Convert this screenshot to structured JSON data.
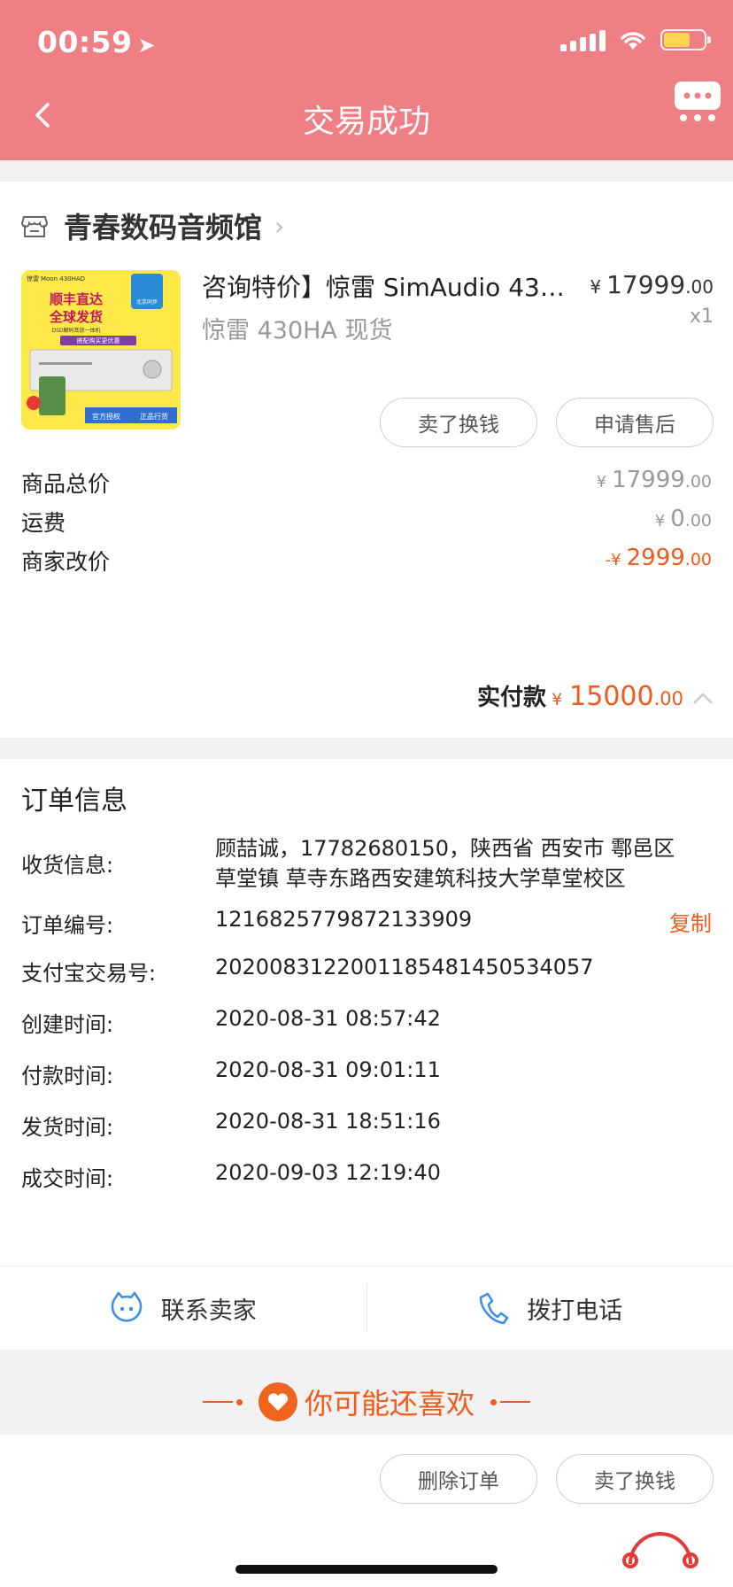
{
  "status_bar": {
    "time": "00:59"
  },
  "header": {
    "title": "交易成功"
  },
  "shop": {
    "name": "青春数码音频馆"
  },
  "product": {
    "title": "咨询特价】惊雷 SimAudio 430...",
    "sku": "惊雷 430HA 现货",
    "price_currency": "¥",
    "price_int": "17999",
    "price_dec": ".00",
    "qty": "x1",
    "image_texts": [
      "惊雷",
      "Moon 430HAD",
      "顺丰直达",
      "全球发货",
      "DSD解码耳放一体机",
      "搭配购买更优惠",
      "北京同步",
      "官方授权",
      "正品行货"
    ]
  },
  "item_actions": {
    "sell_label": "卖了换钱",
    "aftersale_label": "申请售后"
  },
  "fees": {
    "goods_total_label": "商品总价",
    "goods_total_cur": "¥",
    "goods_total_int": "17999",
    "goods_total_dec": ".00",
    "shipping_label": "运费",
    "shipping_cur": "¥",
    "shipping_int": "0",
    "shipping_dec": ".00",
    "adjust_label": "商家改价",
    "adjust_cur": "-¥",
    "adjust_int": "2999",
    "adjust_dec": ".00",
    "paid_label": "实付款",
    "paid_cur": "¥",
    "paid_int": "15000",
    "paid_dec": ".00"
  },
  "order_info": {
    "title": "订单信息",
    "receiver_label": "收货信息:",
    "receiver_line1": "顾喆诚，17782680150，陕西省 西安市 鄠邑区",
    "receiver_line2": "草堂镇 草寺东路西安建筑科技大学草堂校区",
    "order_no_label": "订单编号:",
    "order_no": "1216825779872133909",
    "copy_label": "复制",
    "alipay_label": "支付宝交易号:",
    "alipay_no": "2020083122001185481450534057",
    "created_label": "创建时间:",
    "created": "2020-08-31 08:57:42",
    "paid_time_label": "付款时间:",
    "paid_time": "2020-08-31 09:01:11",
    "shipped_label": "发货时间:",
    "shipped": "2020-08-31 18:51:16",
    "completed_label": "成交时间:",
    "completed": "2020-09-03 12:19:40"
  },
  "contact": {
    "seller_label": "联系卖家",
    "call_label": "拨打电话"
  },
  "recommend": {
    "title": "你可能还喜欢"
  },
  "bottom_actions": {
    "delete_label": "删除订单",
    "sell_label": "卖了换钱"
  },
  "colors": {
    "header": "#ef7f85",
    "accent": "#f05a1a"
  }
}
